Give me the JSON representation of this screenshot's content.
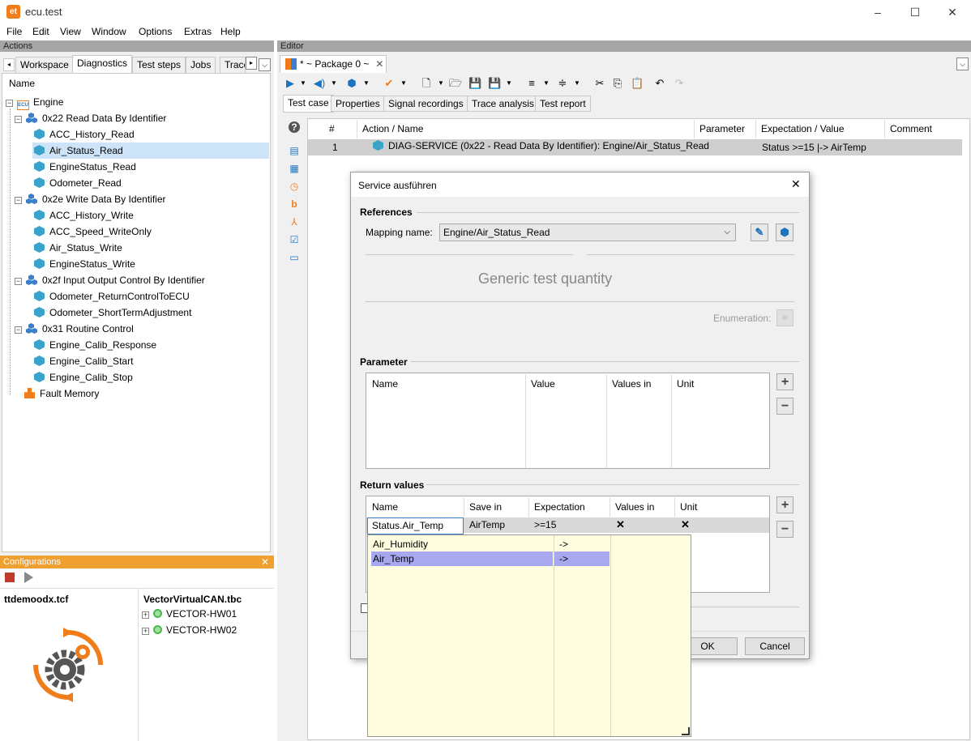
{
  "app": {
    "logo": "et",
    "title": "ecu.test"
  },
  "window": {
    "minimize": "–",
    "maximize": "☐",
    "close": "✕"
  },
  "menu": [
    "File",
    "Edit",
    "View",
    "Window",
    "Options",
    "Extras",
    "Help"
  ],
  "actions": {
    "header": "Actions",
    "tabs": [
      "Workspace",
      "Diagnostics",
      "Test steps",
      "Jobs",
      "Trace"
    ],
    "active_tab": "Diagnostics",
    "column": "Name",
    "tree": {
      "root": "Engine",
      "root_icon": "ecu-icon",
      "groups": [
        {
          "label": "0x22 Read Data By Identifier",
          "items": [
            "ACC_History_Read",
            "Air_Status_Read",
            "EngineStatus_Read",
            "Odometer_Read"
          ]
        },
        {
          "label": "0x2e Write Data By Identifier",
          "items": [
            "ACC_History_Write",
            "ACC_Speed_WriteOnly",
            "Air_Status_Write",
            "EngineStatus_Write"
          ]
        },
        {
          "label": "0x2f Input Output Control By Identifier",
          "items": [
            "Odometer_ReturnControlToECU",
            "Odometer_ShortTermAdjustment"
          ]
        },
        {
          "label": "0x31 Routine Control",
          "items": [
            "Engine_Calib_Response",
            "Engine_Calib_Start",
            "Engine_Calib_Stop"
          ]
        }
      ],
      "fault": "Fault Memory",
      "selected": "Air_Status_Read"
    }
  },
  "configurations": {
    "header": "Configurations",
    "left_title": "ttdemoodx.tcf",
    "right_title": "VectorVirtualCAN.tbc",
    "hw": [
      "VECTOR-HW01",
      "VECTOR-HW02"
    ]
  },
  "editor": {
    "header": "Editor",
    "doc_tab": "* ~ Package 0 ~",
    "subtabs": [
      "Test case",
      "Properties",
      "Signal recordings",
      "Trace analysis",
      "Test report"
    ],
    "active_subtab": "Test case",
    "columns": [
      "#",
      "Action / Name",
      "Parameter",
      "Expectation / Value",
      "Comment"
    ],
    "row": {
      "num": "1",
      "action": "DIAG-SERVICE (0x22 - Read Data By Identifier): Engine/Air_Status_Read",
      "expectation": "Status >=15 |-> AirTemp"
    }
  },
  "dialog": {
    "title": "Service ausführen",
    "references": "References",
    "mapping_label": "Mapping name:",
    "mapping_value": "Engine/Air_Status_Read",
    "generic": "Generic test quantity",
    "enumeration": "Enumeration:",
    "parameter": "Parameter",
    "param_cols": [
      "Name",
      "Value",
      "Values in",
      "Unit"
    ],
    "return_values": "Return values",
    "ret_cols": [
      "Name",
      "Save in",
      "Expectation",
      "Values in",
      "Unit"
    ],
    "ret_row": {
      "name": "Status.Air_Temp",
      "save_in": "AirTemp",
      "expectation": ">=15",
      "values_in": "✕",
      "unit": "✕"
    },
    "ok": "OK",
    "cancel": "Cancel",
    "popup": [
      {
        "name": "Air_Humidity",
        "arrow": "->"
      },
      {
        "name": "Air_Temp",
        "arrow": "->"
      }
    ],
    "popup_selected": "Air_Temp"
  },
  "colors": {
    "accent": "#f07d19",
    "selection": "#cde3f7",
    "popup_sel": "#a8a8f0"
  }
}
